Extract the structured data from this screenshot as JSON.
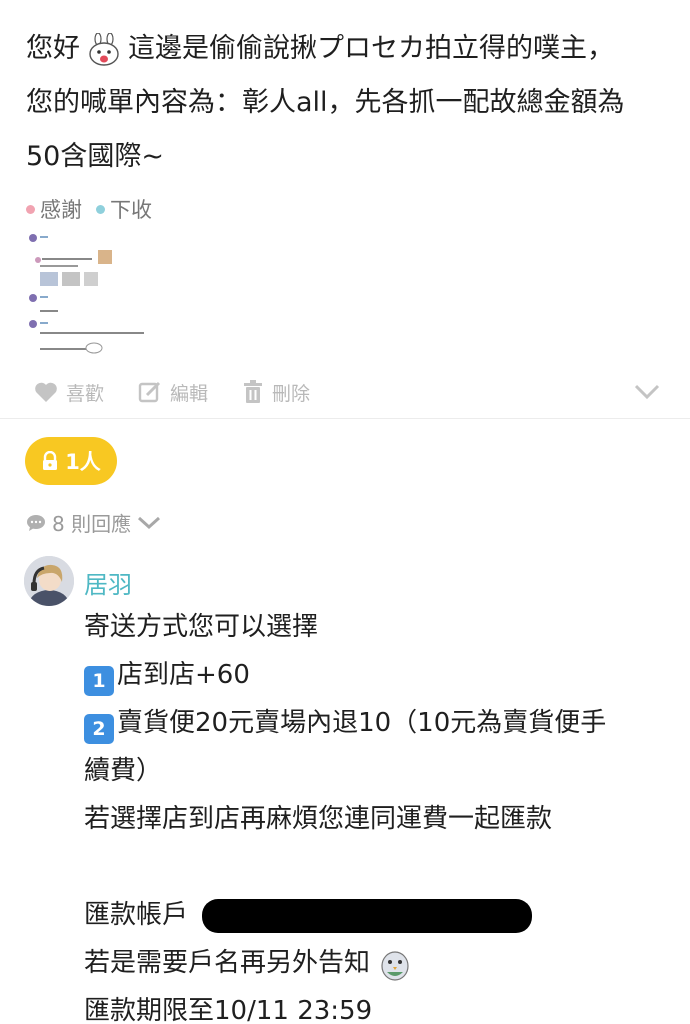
{
  "post": {
    "line1_a": "您好",
    "line1_b": "這邊是偷偷說揪プロセカ拍立得的噗主，",
    "line2": "您的喊單內容為：彰人all，先各抓一配故總金額為",
    "line3": "50含國際~"
  },
  "tags": [
    {
      "label": "感謝",
      "color": "#f1a3b1"
    },
    {
      "label": "下收",
      "color": "#8fd0dc"
    }
  ],
  "actions": {
    "like": "喜歡",
    "edit": "編輯",
    "delete": "刪除"
  },
  "badge": {
    "count": "1人"
  },
  "replies": {
    "count": "8 則回應"
  },
  "comment": {
    "author": "居羽",
    "lines": [
      "寄送方式您可以選擇",
      "店到店+60",
      "賣貨便20元賣場內退10（10元為賣貨便手",
      "續費）",
      "若選擇店到店再麻煩您連同運費一起匯款",
      "",
      "匯款帳戶",
      "若是需要戶名再另外告知",
      "匯款期限至10/11 23:59"
    ],
    "key1": "1",
    "key2": "2"
  },
  "colors": {
    "accent": "#4fb8c4",
    "badge": "#f8c822",
    "keycap": "#3d8fe0"
  }
}
